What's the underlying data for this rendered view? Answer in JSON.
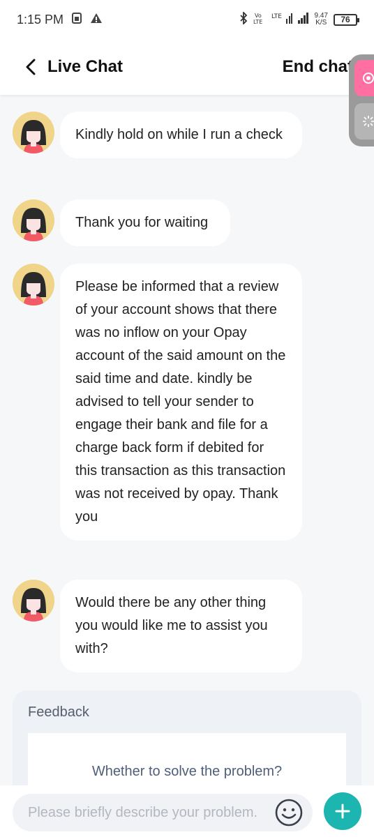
{
  "status_bar": {
    "time": "1:15 PM",
    "net_speed_value": "9.47",
    "net_speed_unit": "K/S",
    "battery": "76",
    "icons": [
      "sim-card-icon",
      "warning-icon",
      "bluetooth-icon",
      "volte-icon",
      "lte-icon",
      "signal-icon",
      "battery-icon"
    ]
  },
  "header": {
    "title": "Live Chat",
    "end_chat": "End chat"
  },
  "messages": [
    {
      "text": "Kindly hold on while I run a check"
    },
    {
      "text": "Thank you for waiting"
    },
    {
      "text": "Please be informed that a review of your account shows that there was no inflow on your Opay account of the said amount on the said time and date. kindly be advised to tell your sender to engage their bank and file for a charge back form if debited for this transaction as this transaction was not received by opay. Thank you"
    },
    {
      "text": "Would there be any other thing you would like me to assist you with?"
    }
  ],
  "feedback": {
    "title": "Feedback",
    "question": "Whether to solve the problem?"
  },
  "input": {
    "placeholder": "Please briefly describe your problem."
  },
  "colors": {
    "accent": "#1db5b0",
    "pink": "#ff6fa2",
    "avatar_bg": "#efd48a"
  }
}
